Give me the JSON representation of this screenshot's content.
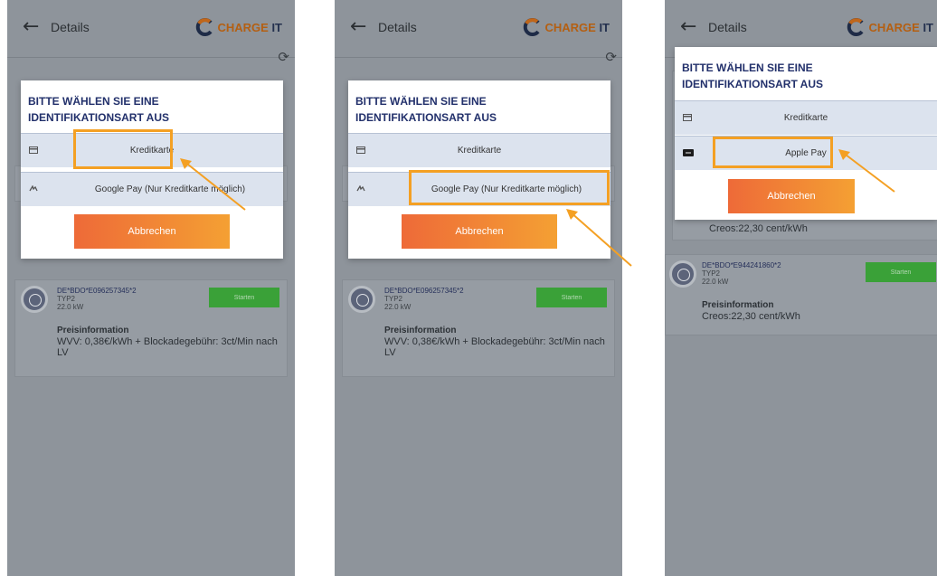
{
  "colors": {
    "accent": "#f4a023",
    "dialog_title": "#22306b",
    "start_green": "#3aa138",
    "cancel_gradient": [
      "#ee6a38",
      "#f4a033"
    ]
  },
  "header": {
    "back_icon": "arrow-left-icon",
    "title": "Details",
    "logo": {
      "mark": "CHARGE",
      "suffix": "IT"
    },
    "refresh_icon": "refresh-icon"
  },
  "panels": [
    {
      "dialog": {
        "title": "BITTE WÄHLEN SIE EINE IDENTIFIKATIONSART AUS",
        "options": [
          {
            "icon": "credit-card-icon",
            "label": "Kreditkarte",
            "highlighted": true
          },
          {
            "icon": "google-pay-icon",
            "label": "Google Pay (Nur Kreditkarte möglich)",
            "highlighted": false
          }
        ],
        "cancel": "Abbrechen"
      },
      "station": {
        "id": "DE*BDO*E096257345*2",
        "type": "TYP2",
        "power": "22.0 kW",
        "start": "Starten",
        "price_label": "Preisinformation",
        "price_value": "WVV: 0,38€/kWh + Blockadegebühr: 3ct/Min nach LV"
      }
    },
    {
      "dialog": {
        "title": "BITTE WÄHLEN SIE EINE IDENTIFIKATIONSART AUS",
        "options": [
          {
            "icon": "credit-card-icon",
            "label": "Kreditkarte",
            "highlighted": false
          },
          {
            "icon": "google-pay-icon",
            "label": "Google Pay (Nur Kreditkarte möglich)",
            "highlighted": true
          }
        ],
        "cancel": "Abbrechen"
      },
      "station": {
        "id": "DE*BDO*E096257345*2",
        "type": "TYP2",
        "power": "22.0 kW",
        "start": "Starten",
        "price_label": "Preisinformation",
        "price_value": "WVV: 0,38€/kWh + Blockadegebühr: 3ct/Min nach LV"
      }
    },
    {
      "dialog": {
        "title": "BITTE WÄHLEN SIE EINE IDENTIFIKATIONSART AUS",
        "options": [
          {
            "icon": "credit-card-icon",
            "label": "Kreditkarte",
            "highlighted": false
          },
          {
            "icon": "apple-pay-icon",
            "label": "Apple Pay",
            "highlighted": true
          }
        ],
        "cancel": "Abbrechen"
      },
      "background_price": "Creos:22,30 cent/kWh",
      "station": {
        "id": "DE*BDO*E944241860*2",
        "type": "TYP2",
        "power": "22.0 kW",
        "start": "Starten",
        "price_label": "Preisinformation",
        "price_value": "Creos:22,30 cent/kWh"
      }
    }
  ]
}
